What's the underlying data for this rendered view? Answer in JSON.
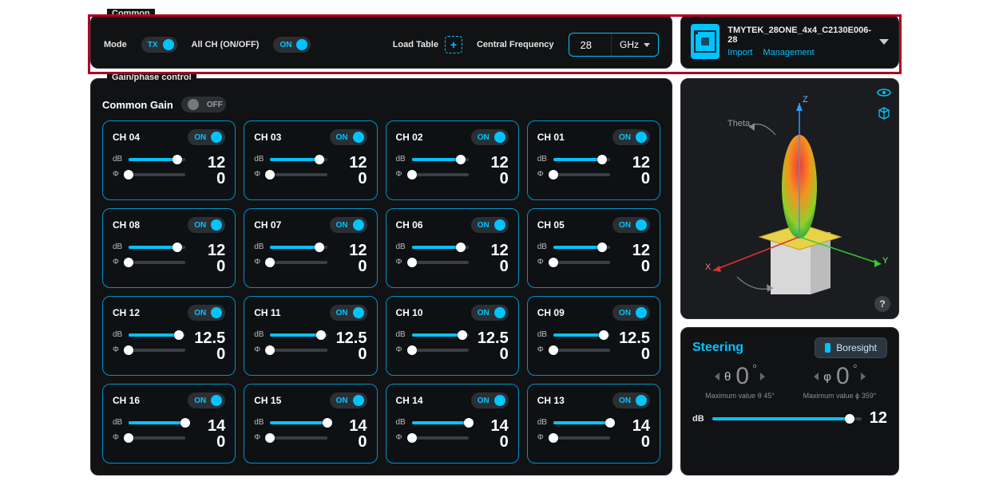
{
  "common": {
    "legend": "Common",
    "mode_label": "Mode",
    "mode_value": "TX",
    "allch_label": "All CH (ON/OFF)",
    "allch_value": "ON",
    "load_table_label": "Load Table",
    "central_freq_label": "Central Frequency",
    "central_freq_value": "28",
    "central_freq_unit": "GHz"
  },
  "device": {
    "name": "TMYTEK_28ONE_4x4_C2130E006-28",
    "import_label": "Import",
    "management_label": "Management"
  },
  "gainphase": {
    "legend": "Gain/phase control",
    "common_gain_label": "Common Gain",
    "common_gain_state": "OFF"
  },
  "channels": [
    {
      "name": "CH 04",
      "on": "ON",
      "db": 12,
      "phi": 0,
      "db_pct": 86,
      "phi_pct": 0
    },
    {
      "name": "CH 03",
      "on": "ON",
      "db": 12,
      "phi": 0,
      "db_pct": 86,
      "phi_pct": 0
    },
    {
      "name": "CH 02",
      "on": "ON",
      "db": 12,
      "phi": 0,
      "db_pct": 86,
      "phi_pct": 0
    },
    {
      "name": "CH 01",
      "on": "ON",
      "db": 12,
      "phi": 0,
      "db_pct": 86,
      "phi_pct": 0
    },
    {
      "name": "CH 08",
      "on": "ON",
      "db": 12,
      "phi": 0,
      "db_pct": 86,
      "phi_pct": 0
    },
    {
      "name": "CH 07",
      "on": "ON",
      "db": 12,
      "phi": 0,
      "db_pct": 86,
      "phi_pct": 0
    },
    {
      "name": "CH 06",
      "on": "ON",
      "db": 12,
      "phi": 0,
      "db_pct": 86,
      "phi_pct": 0
    },
    {
      "name": "CH 05",
      "on": "ON",
      "db": 12,
      "phi": 0,
      "db_pct": 86,
      "phi_pct": 0
    },
    {
      "name": "CH 12",
      "on": "ON",
      "db": 12.5,
      "phi": 0,
      "db_pct": 89,
      "phi_pct": 0
    },
    {
      "name": "CH 11",
      "on": "ON",
      "db": 12.5,
      "phi": 0,
      "db_pct": 89,
      "phi_pct": 0
    },
    {
      "name": "CH 10",
      "on": "ON",
      "db": 12.5,
      "phi": 0,
      "db_pct": 89,
      "phi_pct": 0
    },
    {
      "name": "CH 09",
      "on": "ON",
      "db": 12.5,
      "phi": 0,
      "db_pct": 89,
      "phi_pct": 0
    },
    {
      "name": "CH 16",
      "on": "ON",
      "db": 14,
      "phi": 0,
      "db_pct": 100,
      "phi_pct": 0
    },
    {
      "name": "CH 15",
      "on": "ON",
      "db": 14,
      "phi": 0,
      "db_pct": 100,
      "phi_pct": 0
    },
    {
      "name": "CH 14",
      "on": "ON",
      "db": 14,
      "phi": 0,
      "db_pct": 100,
      "phi_pct": 0
    },
    {
      "name": "CH 13",
      "on": "ON",
      "db": 14,
      "phi": 0,
      "db_pct": 100,
      "phi_pct": 0
    }
  ],
  "slider_labels": {
    "db": "dB",
    "phi": "Φ"
  },
  "viz": {
    "axis_x": "X",
    "axis_y": "Y",
    "axis_z": "Z",
    "theta": "Theta",
    "help": "?"
  },
  "steering": {
    "title": "Steering",
    "boresight": "Boresight",
    "theta_symbol": "θ",
    "phi_symbol": "φ",
    "theta_value": "0",
    "phi_value": "0",
    "theta_note": "Maximum value θ 45°",
    "phi_note": "Maximum value ϕ 359°",
    "db_label": "dB",
    "db_value": "12",
    "db_pct": 92
  }
}
